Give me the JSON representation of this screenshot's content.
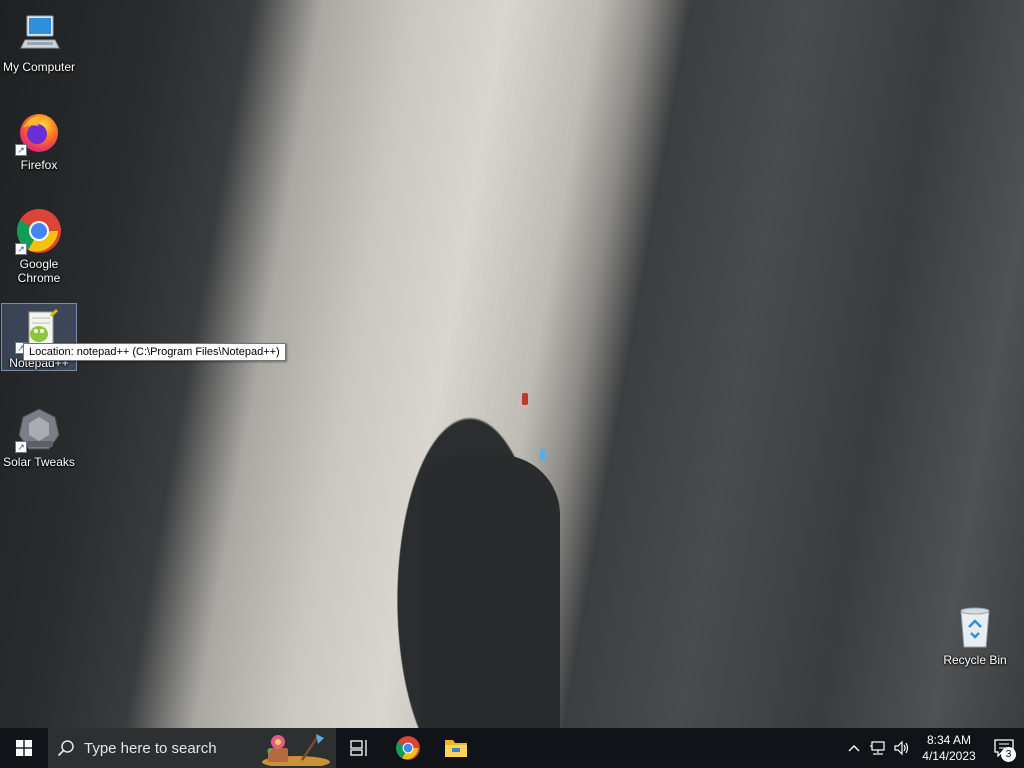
{
  "desktop": {
    "icons": [
      {
        "label": "My Computer",
        "icon": "computer-icon"
      },
      {
        "label": "Firefox",
        "icon": "firefox-icon"
      },
      {
        "label": "Google Chrome",
        "icon": "chrome-icon"
      },
      {
        "label": "Notepad++",
        "icon": "notepad-plus-plus-icon"
      },
      {
        "label": "Solar Tweaks",
        "icon": "solar-tweaks-icon"
      },
      {
        "label": "Recycle Bin",
        "icon": "recycle-bin-icon"
      }
    ],
    "tooltip": "Location: notepad++ (C:\\Program Files\\Notepad++)"
  },
  "taskbar": {
    "search_placeholder": "Type here to search",
    "pinned": [
      "task-view-icon",
      "chrome-icon",
      "file-explorer-icon"
    ],
    "clock": {
      "time": "8:34 AM",
      "date": "4/14/2023"
    },
    "notification_count": "3"
  },
  "colors": {
    "taskbar_bg": "#101418",
    "search_bg": "#2d2f31",
    "accent_blue": "#1a73e8"
  }
}
